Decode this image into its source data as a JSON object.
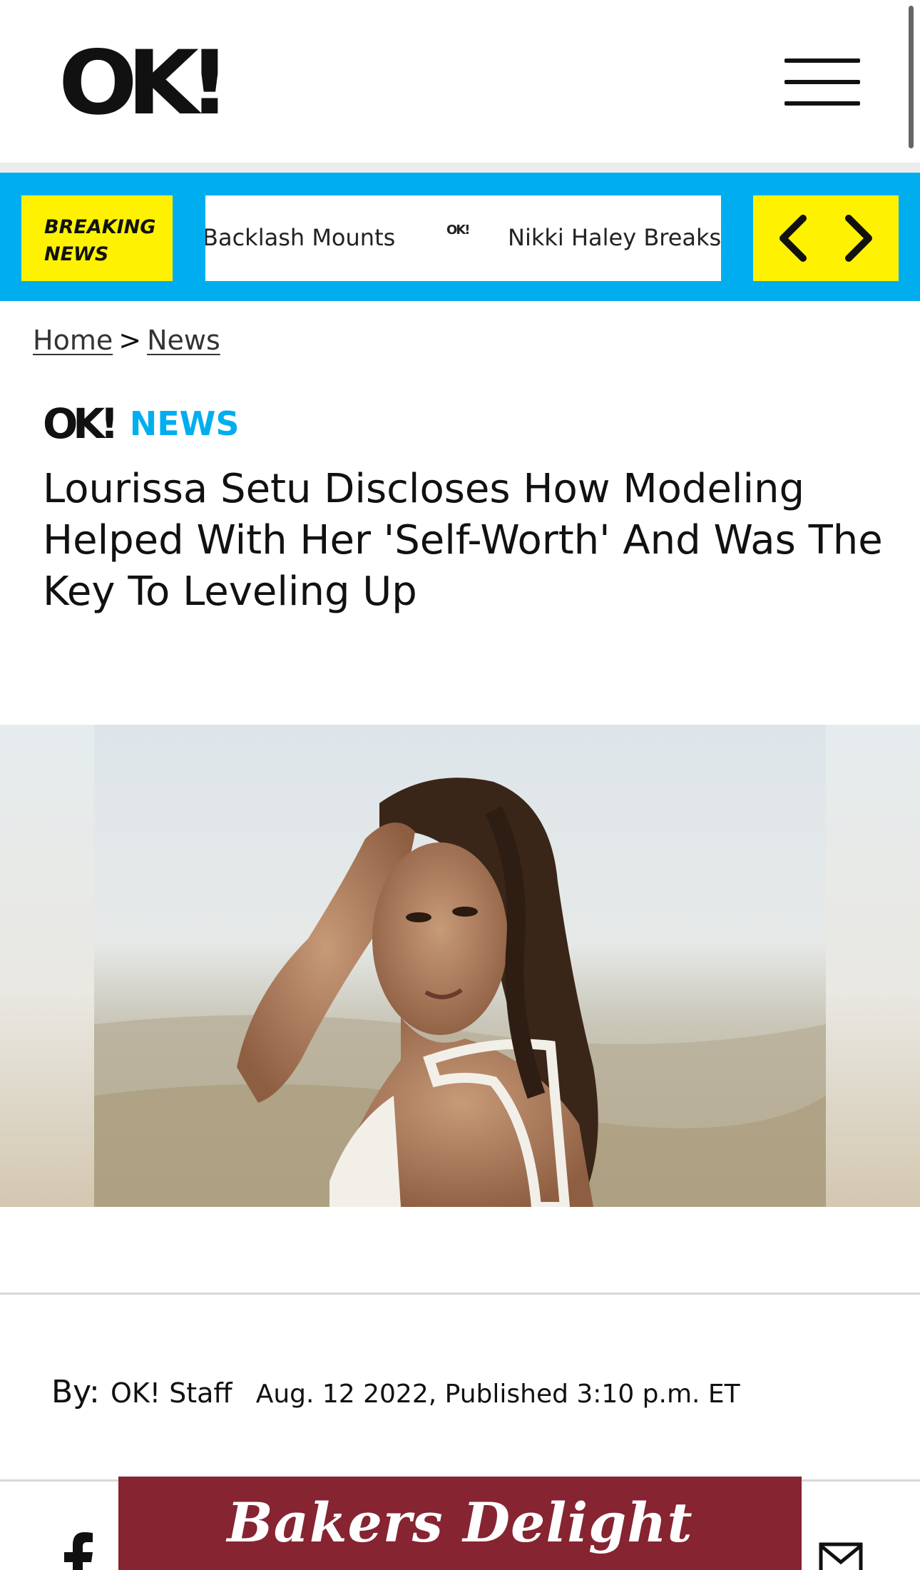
{
  "header": {
    "logo_text": "OK!",
    "menu_icon": "hamburger-menu-icon"
  },
  "breaking": {
    "label_line1": "BREAKING",
    "label_line2": "NEWS",
    "ticker_items": [
      "Backlash Mounts",
      "Nikki Haley Breaks"
    ],
    "separator_logo": "OK!",
    "prev_icon": "chevron-left-icon",
    "next_icon": "chevron-right-icon",
    "accent_color": "#00aeef",
    "label_color": "#fff200"
  },
  "breadcrumb": {
    "home": "Home",
    "separator": ">",
    "section": "News"
  },
  "section_tag": {
    "logo": "OK!",
    "name": "NEWS"
  },
  "article": {
    "headline": "Lourissa Setu Discloses How Modeling Helped With Her 'Self-Worth' And Was The Key To Leveling Up",
    "byline_prefix": "By:",
    "author": "OK! Staff",
    "date": "Aug. 12 2022, Published 3:10 p.m. ET"
  },
  "share": {
    "facebook_icon": "facebook-icon",
    "email_icon": "email-icon"
  },
  "ad": {
    "text": "Bakers Delight",
    "background": "#862432"
  }
}
